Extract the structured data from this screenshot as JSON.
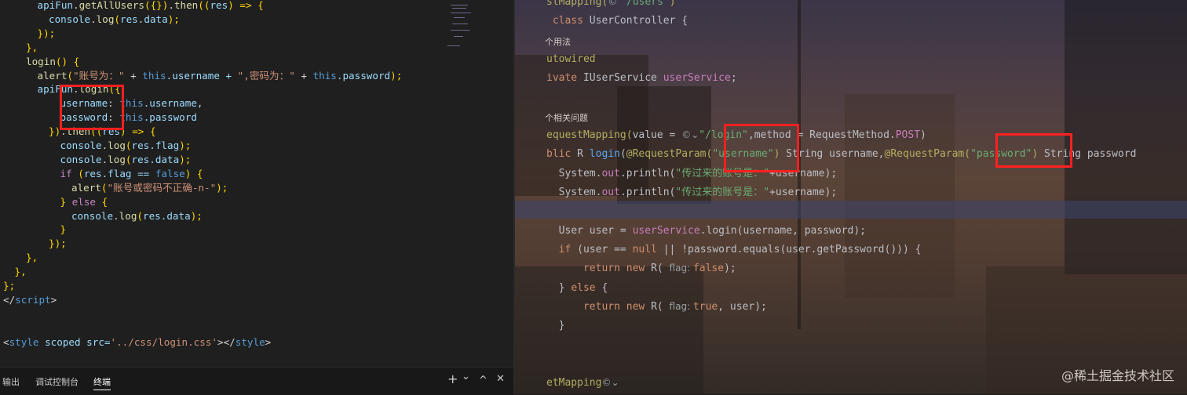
{
  "left_editor": {
    "lines": [
      {
        "indent": 3,
        "segments": [
          {
            "t": "apiFun",
            "c": "var"
          },
          {
            "t": ".",
            "c": "plain"
          },
          {
            "t": "getAllUsers",
            "c": "fn"
          },
          {
            "t": "({})",
            "c": "punc"
          },
          {
            "t": ".",
            "c": "plain"
          },
          {
            "t": "then",
            "c": "fn"
          },
          {
            "t": "((",
            "c": "punc"
          },
          {
            "t": "res",
            "c": "var"
          },
          {
            "t": ") => {",
            "c": "punc"
          }
        ]
      },
      {
        "indent": 4,
        "segments": [
          {
            "t": "console",
            "c": "var"
          },
          {
            "t": ".",
            "c": "plain"
          },
          {
            "t": "log",
            "c": "fn"
          },
          {
            "t": "(",
            "c": "punc"
          },
          {
            "t": "res",
            "c": "var"
          },
          {
            "t": ".",
            "c": "plain"
          },
          {
            "t": "data",
            "c": "var"
          },
          {
            "t": ");",
            "c": "punc"
          }
        ]
      },
      {
        "indent": 3,
        "segments": [
          {
            "t": "});",
            "c": "punc"
          }
        ]
      },
      {
        "indent": 2,
        "segments": [
          {
            "t": "},",
            "c": "punc"
          }
        ]
      },
      {
        "indent": 2,
        "segments": [
          {
            "t": "login",
            "c": "fn"
          },
          {
            "t": "() {",
            "c": "punc"
          }
        ]
      },
      {
        "indent": 3,
        "segments": [
          {
            "t": "alert",
            "c": "fn"
          },
          {
            "t": "(",
            "c": "punc"
          },
          {
            "t": "\"账号为：\"",
            "c": "str"
          },
          {
            "t": " + ",
            "c": "plain"
          },
          {
            "t": "this",
            "c": "thisk"
          },
          {
            "t": ".username + ",
            "c": "var"
          },
          {
            "t": "\",密码为：\"",
            "c": "str"
          },
          {
            "t": " + ",
            "c": "plain"
          },
          {
            "t": "this",
            "c": "thisk"
          },
          {
            "t": ".password",
            "c": "var"
          },
          {
            "t": ");",
            "c": "punc"
          }
        ]
      },
      {
        "indent": 3,
        "segments": [
          {
            "t": "apiFun",
            "c": "var"
          },
          {
            "t": ".",
            "c": "plain"
          },
          {
            "t": "login",
            "c": "fn"
          },
          {
            "t": "({",
            "c": "punc"
          }
        ]
      },
      {
        "indent": 5,
        "segments": [
          {
            "t": "username",
            "c": "var"
          },
          {
            "t": ": ",
            "c": "plain"
          },
          {
            "t": "this",
            "c": "thisk"
          },
          {
            "t": ".username,",
            "c": "var"
          }
        ]
      },
      {
        "indent": 5,
        "segments": [
          {
            "t": "password",
            "c": "var"
          },
          {
            "t": ": ",
            "c": "plain"
          },
          {
            "t": "this",
            "c": "thisk"
          },
          {
            "t": ".password",
            "c": "var"
          }
        ]
      },
      {
        "indent": 4,
        "segments": [
          {
            "t": "})",
            "c": "punc"
          },
          {
            "t": ".",
            "c": "plain"
          },
          {
            "t": "then",
            "c": "fn"
          },
          {
            "t": "((",
            "c": "punc"
          },
          {
            "t": "res",
            "c": "var"
          },
          {
            "t": ") => {",
            "c": "punc"
          }
        ]
      },
      {
        "indent": 5,
        "segments": [
          {
            "t": "console",
            "c": "var"
          },
          {
            "t": ".",
            "c": "plain"
          },
          {
            "t": "log",
            "c": "fn"
          },
          {
            "t": "(",
            "c": "punc"
          },
          {
            "t": "res",
            "c": "var"
          },
          {
            "t": ".flag",
            "c": "var"
          },
          {
            "t": ");",
            "c": "punc"
          }
        ]
      },
      {
        "indent": 5,
        "segments": [
          {
            "t": "console",
            "c": "var"
          },
          {
            "t": ".",
            "c": "plain"
          },
          {
            "t": "log",
            "c": "fn"
          },
          {
            "t": "(",
            "c": "punc"
          },
          {
            "t": "res",
            "c": "var"
          },
          {
            "t": ".data",
            "c": "var"
          },
          {
            "t": ");",
            "c": "punc"
          }
        ]
      },
      {
        "indent": 5,
        "segments": [
          {
            "t": "if",
            "c": "kw"
          },
          {
            "t": " (",
            "c": "punc"
          },
          {
            "t": "res",
            "c": "var"
          },
          {
            "t": ".flag == ",
            "c": "var"
          },
          {
            "t": "false",
            "c": "thisk"
          },
          {
            "t": ") {",
            "c": "punc"
          }
        ]
      },
      {
        "indent": 6,
        "segments": [
          {
            "t": "alert",
            "c": "fn"
          },
          {
            "t": "(",
            "c": "punc"
          },
          {
            "t": "\"账号或密码不正确-n-\"",
            "c": "str"
          },
          {
            "t": ");",
            "c": "punc"
          }
        ]
      },
      {
        "indent": 5,
        "segments": [
          {
            "t": "} ",
            "c": "punc"
          },
          {
            "t": "else",
            "c": "kw"
          },
          {
            "t": " {",
            "c": "punc"
          }
        ]
      },
      {
        "indent": 6,
        "segments": [
          {
            "t": "console",
            "c": "var"
          },
          {
            "t": ".",
            "c": "plain"
          },
          {
            "t": "log",
            "c": "fn"
          },
          {
            "t": "(",
            "c": "punc"
          },
          {
            "t": "res",
            "c": "var"
          },
          {
            "t": ".data",
            "c": "var"
          },
          {
            "t": ");",
            "c": "punc"
          }
        ]
      },
      {
        "indent": 5,
        "segments": [
          {
            "t": "}",
            "c": "punc"
          }
        ]
      },
      {
        "indent": 4,
        "segments": [
          {
            "t": "});",
            "c": "punc"
          }
        ]
      },
      {
        "indent": 2,
        "segments": [
          {
            "t": "},",
            "c": "punc"
          }
        ]
      },
      {
        "indent": 1,
        "segments": [
          {
            "t": "},",
            "c": "punc"
          }
        ]
      },
      {
        "indent": 0,
        "segments": [
          {
            "t": "};",
            "c": "punc"
          }
        ]
      },
      {
        "indent": 0,
        "segments": [
          {
            "t": "</",
            "c": "plain"
          },
          {
            "t": "script",
            "c": "tag"
          },
          {
            "t": ">",
            "c": "plain"
          }
        ]
      },
      {
        "indent": 0,
        "segments": []
      },
      {
        "indent": 0,
        "segments": []
      },
      {
        "indent": 0,
        "segments": [
          {
            "t": "<",
            "c": "plain"
          },
          {
            "t": "style",
            "c": "tag"
          },
          {
            "t": " scoped src=",
            "c": "attr"
          },
          {
            "t": "'../css/login.css'",
            "c": "str"
          },
          {
            "t": "></",
            "c": "plain"
          },
          {
            "t": "style",
            "c": "tag"
          },
          {
            "t": ">",
            "c": "plain"
          }
        ]
      }
    ]
  },
  "bottom_panel": {
    "tabs": [
      "输出",
      "调试控制台",
      "终端"
    ],
    "active_tab": "终端",
    "add_button": "+",
    "dropdown_button": "⌄",
    "maximize_button": "^",
    "close_button": "✕"
  },
  "right_editor": {
    "lines": [
      {
        "row": 0,
        "segments": [
          {
            "t": "stMapping(",
            "c": "jann"
          },
          {
            "t": "© ",
            "c": "jhint"
          },
          {
            "t": "\"/users\"",
            "c": "jstr"
          },
          {
            "t": ")",
            "c": "jann"
          }
        ]
      },
      {
        "row": 1,
        "segments": [
          {
            "t": " class ",
            "c": "jk"
          },
          {
            "t": "UserController {",
            "c": "jplain"
          }
        ]
      },
      {
        "row": 2,
        "hint": "个用法"
      },
      {
        "row": 3,
        "segments": [
          {
            "t": "utowired",
            "c": "jann"
          }
        ]
      },
      {
        "row": 4,
        "segments": [
          {
            "t": "ivate ",
            "c": "jk"
          },
          {
            "t": "IUserService ",
            "c": "jplain"
          },
          {
            "t": "userService",
            "c": "jfield"
          },
          {
            "t": ";",
            "c": "jplain"
          }
        ]
      },
      {
        "row": 5,
        "segments": []
      },
      {
        "row": 6,
        "hint": "个相关问题"
      },
      {
        "row": 7,
        "segments": [
          {
            "t": "equestMapping(",
            "c": "jann"
          },
          {
            "t": "value = ",
            "c": "jplain"
          },
          {
            "t": "©⌄",
            "c": "jhint"
          },
          {
            "t": "\"/login\"",
            "c": "jstr"
          },
          {
            "t": ",method = RequestMethod.",
            "c": "jplain"
          },
          {
            "t": "POST",
            "c": "jfield"
          },
          {
            "t": ")",
            "c": "jplain"
          }
        ]
      },
      {
        "row": 8,
        "segments": [
          {
            "t": "blic ",
            "c": "jk"
          },
          {
            "t": "R ",
            "c": "jplain"
          },
          {
            "t": "login",
            "c": "jfn"
          },
          {
            "t": "(",
            "c": "jplain"
          },
          {
            "t": "@RequestParam(",
            "c": "jann"
          },
          {
            "t": "\"username\"",
            "c": "jstr"
          },
          {
            "t": ") ",
            "c": "jann"
          },
          {
            "t": "String username,",
            "c": "jplain"
          },
          {
            "t": "@RequestParam(",
            "c": "jann"
          },
          {
            "t": "\"password\"",
            "c": "jstr"
          },
          {
            "t": ") ",
            "c": "jann"
          },
          {
            "t": "String password",
            "c": "jplain"
          }
        ]
      },
      {
        "row": 9,
        "segments": [
          {
            "t": "  System.",
            "c": "jplain"
          },
          {
            "t": "out",
            "c": "jfield"
          },
          {
            "t": ".println(",
            "c": "jplain"
          },
          {
            "t": "\"传过来的账号是：\"",
            "c": "jstr"
          },
          {
            "t": "+username);",
            "c": "jplain"
          }
        ]
      },
      {
        "row": 10,
        "segments": [
          {
            "t": "  System.",
            "c": "jplain"
          },
          {
            "t": "out",
            "c": "jfield"
          },
          {
            "t": ".println(",
            "c": "jplain"
          },
          {
            "t": "\"传过来的账号是：\"",
            "c": "jstr"
          },
          {
            "t": "+username);",
            "c": "jplain"
          }
        ]
      },
      {
        "row": 11,
        "segments": []
      },
      {
        "row": 12,
        "segments": [
          {
            "t": "  User user = ",
            "c": "jplain"
          },
          {
            "t": "userService",
            "c": "jfield"
          },
          {
            "t": ".login(username, password);",
            "c": "jplain"
          }
        ]
      },
      {
        "row": 13,
        "segments": [
          {
            "t": "  if ",
            "c": "jk"
          },
          {
            "t": "(user == ",
            "c": "jplain"
          },
          {
            "t": "null",
            "c": "jk"
          },
          {
            "t": " || !password.equals(user.getPassword())) {",
            "c": "jplain"
          }
        ]
      },
      {
        "row": 14,
        "segments": [
          {
            "t": "      return new ",
            "c": "jk"
          },
          {
            "t": "R( ",
            "c": "jplain"
          },
          {
            "t": "flag: ",
            "c": "jhint"
          },
          {
            "t": "false",
            "c": "jk"
          },
          {
            "t": ");",
            "c": "jplain"
          }
        ]
      },
      {
        "row": 15,
        "segments": [
          {
            "t": "  } ",
            "c": "jplain"
          },
          {
            "t": "else",
            "c": "jk"
          },
          {
            "t": " {",
            "c": "jplain"
          }
        ]
      },
      {
        "row": 16,
        "segments": [
          {
            "t": "      return new ",
            "c": "jk"
          },
          {
            "t": "R( ",
            "c": "jplain"
          },
          {
            "t": "flag: ",
            "c": "jhint"
          },
          {
            "t": "true",
            "c": "jk"
          },
          {
            "t": ", user);",
            "c": "jplain"
          }
        ]
      },
      {
        "row": 17,
        "segments": [
          {
            "t": "  }",
            "c": "jplain"
          }
        ]
      },
      {
        "row": 18,
        "segments": []
      },
      {
        "row": 19,
        "segments": []
      },
      {
        "row": 20,
        "segments": [
          {
            "t": "etMapping",
            "c": "jann"
          },
          {
            "t": "©⌄",
            "c": "jhint"
          }
        ]
      }
    ]
  },
  "watermark": "@稀土掘金技术社区",
  "colors": {
    "highlight_box": "#ff2020",
    "left_bg": "#1f1f1f"
  }
}
